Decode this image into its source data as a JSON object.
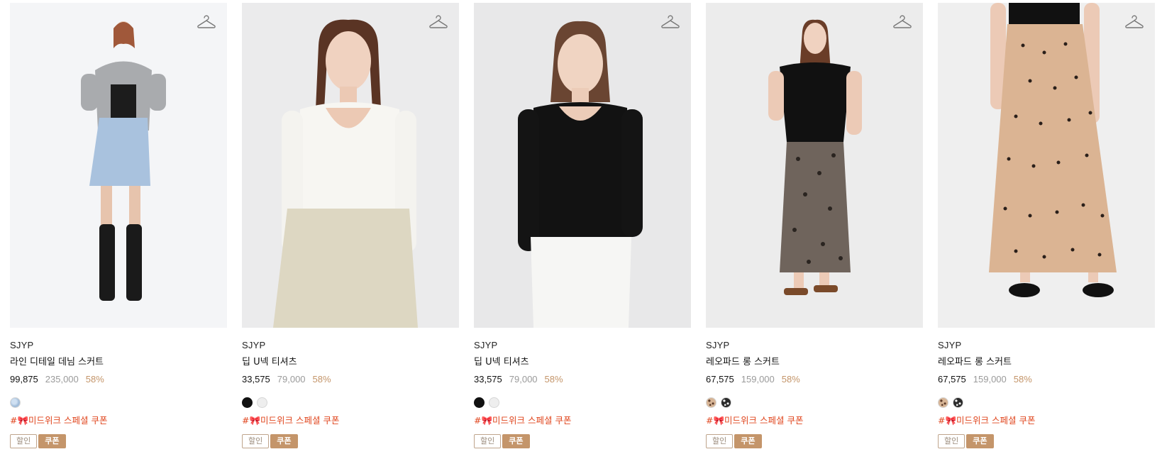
{
  "products": [
    {
      "brand": "SJYP",
      "name": "라인 디테일 데님 스커트",
      "sale_price": "99,875",
      "original_price": "235,000",
      "discount_rate": "58%",
      "swatches": [
        "denim"
      ],
      "promo": "#🎀미드위크 스페셜 쿠폰",
      "badges": {
        "sale": "할인",
        "coupon": "쿠폰"
      },
      "photo": "model in grey short-sleeve hoodie, light denim mini skirt, black boots"
    },
    {
      "brand": "SJYP",
      "name": "딥 U넥 티셔츠",
      "sale_price": "33,575",
      "original_price": "79,000",
      "discount_rate": "58%",
      "swatches": [
        "black",
        "ivory"
      ],
      "promo": "#🎀미드위크 스페셜 쿠폰",
      "badges": {
        "sale": "할인",
        "coupon": "쿠폰"
      },
      "photo": "model in white long-sleeve scoop neck top, beige skirt"
    },
    {
      "brand": "SJYP",
      "name": "딥 U넥 티셔츠",
      "sale_price": "33,575",
      "original_price": "79,000",
      "discount_rate": "58%",
      "swatches": [
        "black",
        "ivory"
      ],
      "promo": "#🎀미드위크 스페셜 쿠폰",
      "badges": {
        "sale": "할인",
        "coupon": "쿠폰"
      },
      "photo": "model in black long-sleeve scoop neck top, white skirt"
    },
    {
      "brand": "SJYP",
      "name": "레오파드 롱 스커트",
      "sale_price": "67,575",
      "original_price": "159,000",
      "discount_rate": "58%",
      "swatches": [
        "leo-beige",
        "leo-black"
      ],
      "promo": "#🎀미드위크 스페셜 쿠폰",
      "badges": {
        "sale": "할인",
        "coupon": "쿠폰"
      },
      "photo": "model in black tee, black leopard long skirt, brown sandals"
    },
    {
      "brand": "SJYP",
      "name": "레오파드 롱 스커트",
      "sale_price": "67,575",
      "original_price": "159,000",
      "discount_rate": "58%",
      "swatches": [
        "leo-beige",
        "leo-black"
      ],
      "promo": "#🎀미드위크 스페셜 쿠폰",
      "badges": {
        "sale": "할인",
        "coupon": "쿠폰"
      },
      "photo": "beige polka dot long skirt, black flats"
    }
  ],
  "colors": {
    "accent": "#c4956a",
    "promo": "#e0461e",
    "muted": "#9a9a9a"
  },
  "icons": {
    "wishlist": "hanger-icon",
    "promo": "ribbon-icon"
  }
}
